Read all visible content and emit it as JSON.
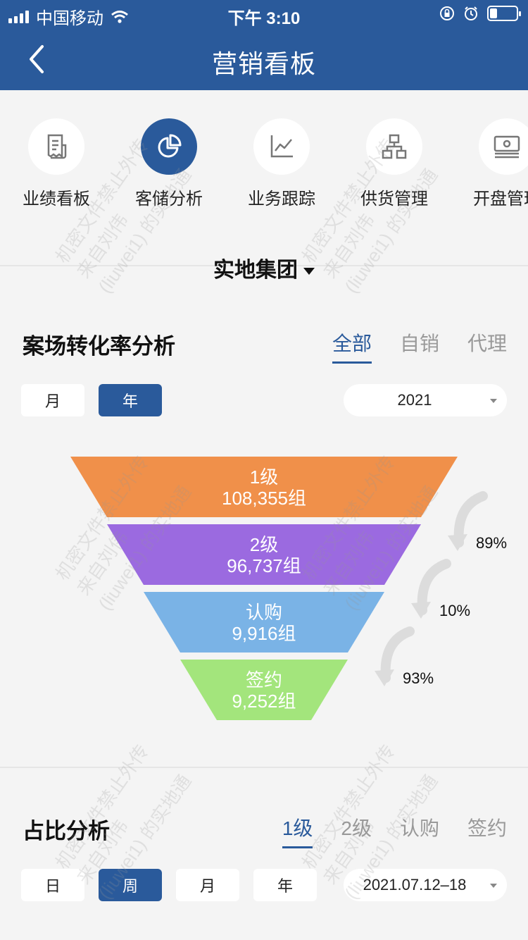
{
  "status_bar": {
    "carrier": "中国移动",
    "time": "下午 3:10"
  },
  "nav": {
    "title": "营销看板"
  },
  "features": [
    {
      "label": "业绩看板",
      "icon": "report-icon",
      "active": false
    },
    {
      "label": "客储分析",
      "icon": "pie-chart-icon",
      "active": true
    },
    {
      "label": "业务跟踪",
      "icon": "line-chart-icon",
      "active": false
    },
    {
      "label": "供货管理",
      "icon": "org-chart-icon",
      "active": false
    },
    {
      "label": "开盘管理",
      "icon": "cash-icon",
      "active": false
    }
  ],
  "group_selector": {
    "value": "实地集团"
  },
  "conversion": {
    "title": "案场转化率分析",
    "tabs": [
      "全部",
      "自销",
      "代理"
    ],
    "active_tab": "全部",
    "period_buttons": [
      "月",
      "年"
    ],
    "active_period": "年",
    "date_value": "2021"
  },
  "chart_data": {
    "type": "funnel",
    "stages": [
      {
        "name": "1级",
        "value_text": "108,355组",
        "value": 108355,
        "color": "#f0904a"
      },
      {
        "name": "2级",
        "value_text": "96,737组",
        "value": 96737,
        "color": "#9b6ae0"
      },
      {
        "name": "认购",
        "value_text": "9,916组",
        "value": 9916,
        "color": "#7ab3e6"
      },
      {
        "name": "签约",
        "value_text": "9,252组",
        "value": 9252,
        "color": "#a3e57c"
      }
    ],
    "conversion_rates": [
      "89%",
      "10%",
      "93%"
    ]
  },
  "ratio": {
    "title": "占比分析",
    "tabs": [
      "1级",
      "2级",
      "认购",
      "签约"
    ],
    "active_tab": "1级",
    "period_buttons": [
      "日",
      "周",
      "月",
      "年"
    ],
    "active_period": "周",
    "date_value": "2021.07.12–18"
  },
  "watermark": {
    "line1": "机密文件禁止外传",
    "line2": "来自刘伟",
    "line3": "(liuwei1) 的实地通"
  },
  "colors": {
    "brand": "#2a5a9b",
    "background": "#f4f4f4"
  }
}
